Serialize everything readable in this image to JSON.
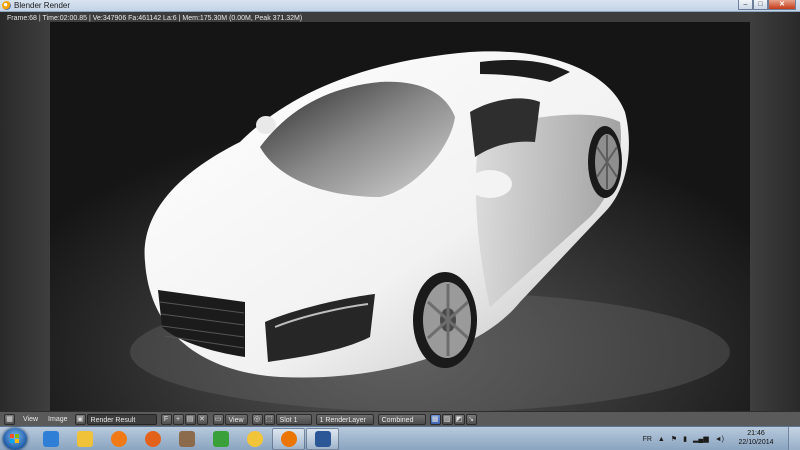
{
  "window": {
    "title": "Blender Render",
    "buttons": {
      "minimize": "–",
      "maximize": "□",
      "close": "✕"
    }
  },
  "render": {
    "stats": "Frame:68 | Time:02:00.85 | Ve:347906 Fa:461142 La:6 | Mem:175.30M (0.00M, Peak 371.32M)"
  },
  "header": {
    "menu_view": "View",
    "menu_image": "Image",
    "image_name": "Render Result",
    "fake_user_label": "F",
    "view_menu": "View",
    "slot": "Slot 1",
    "render_layer": "1 RenderLayer",
    "pass": "Combined"
  },
  "taskbar": {
    "apps": [
      {
        "name": "internet-explorer-icon",
        "color": "#2f7fd6"
      },
      {
        "name": "file-explorer-icon",
        "color": "#f0c23a"
      },
      {
        "name": "media-player-icon",
        "color": "#f07a15"
      },
      {
        "name": "firefox-icon",
        "color": "#e2621b"
      },
      {
        "name": "game-app-icon",
        "color": "#8c6a4c"
      },
      {
        "name": "app-green-icon",
        "color": "#3aa13a"
      },
      {
        "name": "app-yellow-icon",
        "color": "#f2c43a"
      },
      {
        "name": "blender-icon",
        "color": "#ea7600"
      },
      {
        "name": "word-icon",
        "color": "#2b5797"
      }
    ],
    "language": "FR",
    "time": "21:46",
    "date": "22/10/2014"
  }
}
